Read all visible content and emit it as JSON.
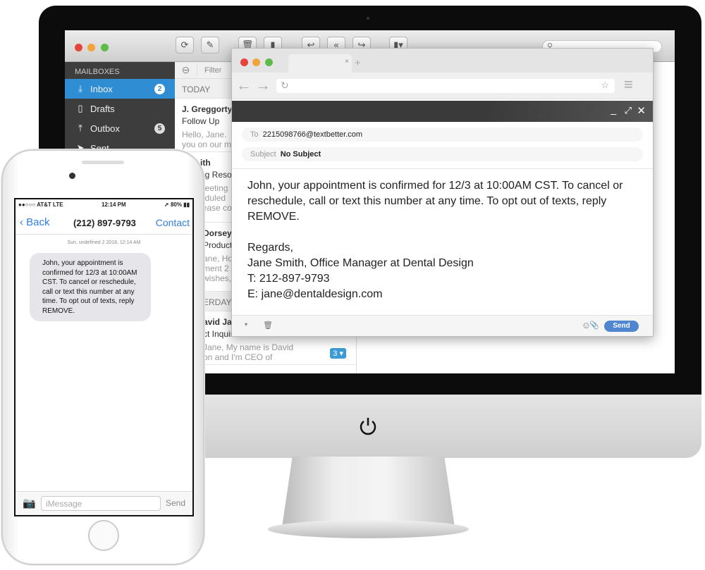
{
  "mail": {
    "toolbar": {
      "icons": [
        "refresh-icon",
        "compose-icon",
        "trash-icon",
        "archive-icon",
        "reply-icon",
        "reply-all-icon",
        "forward-icon",
        "move-icon"
      ],
      "search_placeholder": ""
    },
    "sidebar": {
      "header": "MAILBOXES",
      "items": [
        {
          "label": "Inbox",
          "badge": "2",
          "icon": "inbox-icon"
        },
        {
          "label": "Drafts",
          "badge": "",
          "icon": "document-icon"
        },
        {
          "label": "Outbox",
          "badge": "5",
          "icon": "outbox-icon"
        },
        {
          "label": "Sent",
          "badge": "",
          "icon": "send-icon"
        }
      ]
    },
    "list": {
      "filter": "Filter",
      "today": "TODAY",
      "yesterday": "ERDAY",
      "messages": [
        {
          "from": "J. Greggorty",
          "subject": "Follow Up",
          "preview1": "Hello, Jane.",
          "preview2": "you on our m"
        },
        {
          "from": "ith",
          "subject": "ng Reso",
          "preview1": "neeting",
          "preview2": "eduled",
          "preview3": "lease co"
        },
        {
          "from": "Dorsey",
          "subject": "Product",
          "preview1": "ane, Ho",
          "preview2": "ment 2",
          "preview3": "wishes,"
        }
      ],
      "yesterday_messages": [
        {
          "from": "avid Ja",
          "subject": "ct Inquiries",
          "preview1": "Jane, My name is David",
          "preview2": "on and I'm CEO of",
          "count": "3"
        }
      ]
    }
  },
  "compose": {
    "to_label": "To",
    "to": "2215098766@textbetter.com",
    "subject_label": "Subject",
    "subject": "No Subject",
    "body": [
      "John, your appointment is confirmed for 12/3 at 10:00AM CST. To cancel or reschedule, call or text this number at any time.  To opt out of texts, reply REMOVE.",
      "Regards,",
      "Jane Smith, Office Manager at Dental Design",
      "T: 212-897-9793",
      "E: jane@dentaldesign.com"
    ],
    "send": "Send"
  },
  "phone": {
    "carrier": "●●○○○ AT&T LTE",
    "time": "12:14 PM",
    "battery": "80%",
    "back": "Back",
    "title": "(212) 897-9793",
    "contact": "Contact",
    "timestamp": "Sun, undefined 2 2018, 12:14 AM",
    "message": "John, your appointment is confirmed for 12/3 at 10:00AM CST. To cancel or reschedule, call or text this number at any time.  To opt out of texts, reply REMOVE.",
    "input_placeholder": "iMessage",
    "send": "Send"
  },
  "colors": {
    "accent": "#2f8ed3",
    "send": "#4f86cf",
    "ios_blue": "#2f7fe0"
  }
}
